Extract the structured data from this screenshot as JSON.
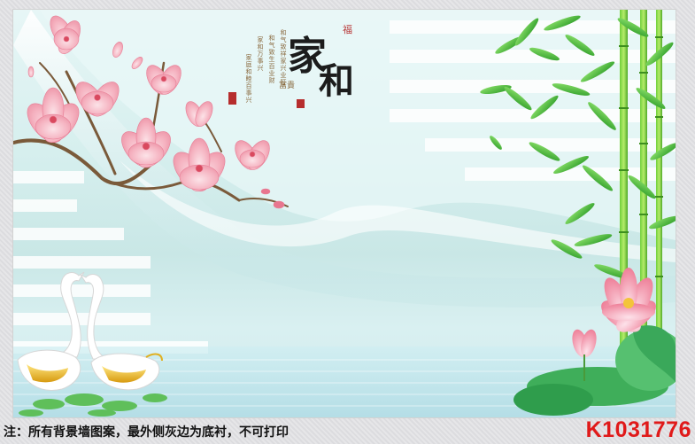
{
  "caption": {
    "note_text": "注：所有背景墙图案，最外侧灰边为底衬，不可打印",
    "product_code": "K1031776"
  },
  "mural": {
    "title_chars": [
      "家",
      "和"
    ],
    "sub_small": "福",
    "sub_seal": "富貴",
    "poem_lines": [
      "和气致祥家兴业旺",
      "和气致生百业财",
      "家和万事兴",
      "家庭和睦百事兴"
    ],
    "accent_colors": {
      "magnolia": "#f4a9b8",
      "bamboo": "#4fbf3a",
      "lotus": "#f48fa4",
      "swan_gold": "#e5b11e",
      "sky": "#d6efee"
    }
  }
}
